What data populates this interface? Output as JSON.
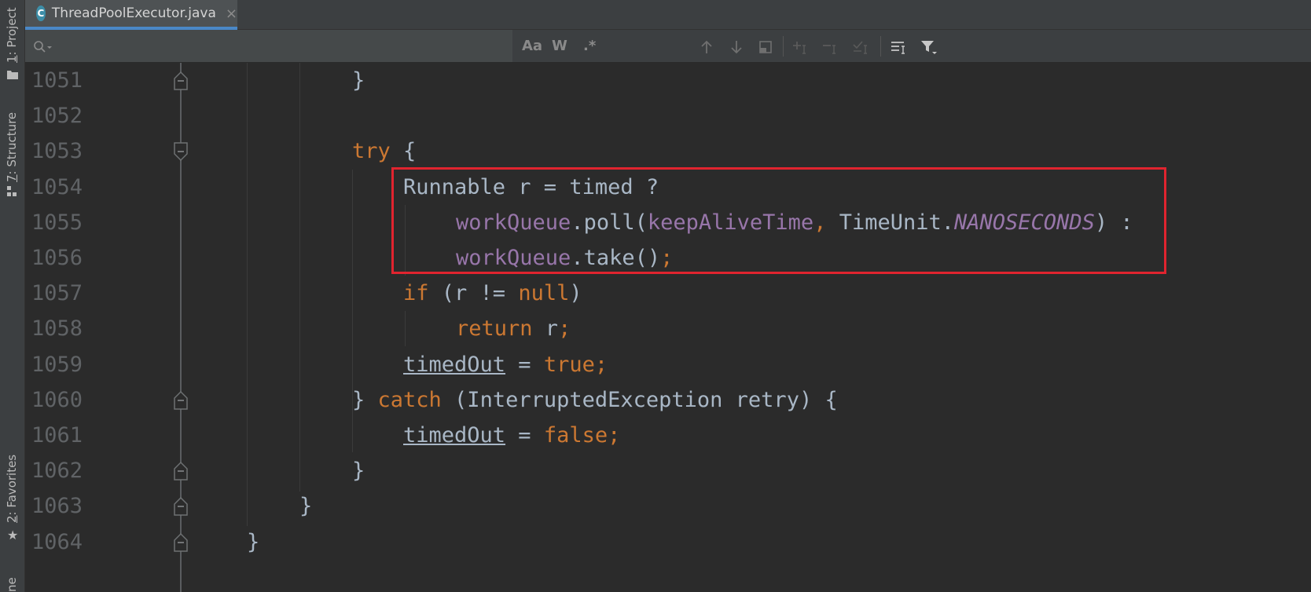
{
  "tool_windows": {
    "project": {
      "number": "1",
      "label": ": Project"
    },
    "structure": {
      "number": "7",
      "label": ": Structure"
    },
    "favorites": {
      "number": "2",
      "label": ": Favorites"
    },
    "bottom_partial": "ne"
  },
  "tab": {
    "file_icon_letter": "C",
    "title": "ThreadPoolExecutor.java",
    "close_glyph": "×"
  },
  "search": {
    "value": "",
    "placeholder": "",
    "match_case": "Aa",
    "words": "W",
    "regex": ".*"
  },
  "editor": {
    "lines": [
      {
        "number": "1051",
        "tokens": [
          {
            "t": "}",
            "c": ""
          }
        ]
      },
      {
        "number": "1052",
        "tokens": []
      },
      {
        "number": "1053",
        "tokens": [
          {
            "t": "try",
            "c": "kw"
          },
          {
            "t": " {",
            "c": ""
          }
        ]
      },
      {
        "number": "1054",
        "tokens": [
          {
            "t": "Runnable r = timed ?",
            "c": ""
          }
        ]
      },
      {
        "number": "1055",
        "tokens": [
          {
            "t": "workQueue",
            "c": "fld"
          },
          {
            "t": ".poll(",
            "c": ""
          },
          {
            "t": "keepAliveTime",
            "c": "fld"
          },
          {
            "t": ", ",
            "c": "kw"
          },
          {
            "t": "TimeUnit.",
            "c": ""
          },
          {
            "t": "NANOSECONDS",
            "c": "cst"
          },
          {
            "t": ") :",
            "c": ""
          }
        ]
      },
      {
        "number": "1056",
        "tokens": [
          {
            "t": "workQueue",
            "c": "fld"
          },
          {
            "t": ".take()",
            "c": ""
          },
          {
            "t": ";",
            "c": "kw"
          }
        ]
      },
      {
        "number": "1057",
        "tokens": [
          {
            "t": "if",
            "c": "kw"
          },
          {
            "t": " (r != ",
            "c": ""
          },
          {
            "t": "null",
            "c": "kw"
          },
          {
            "t": ")",
            "c": ""
          }
        ]
      },
      {
        "number": "1058",
        "tokens": [
          {
            "t": "return",
            "c": "kw"
          },
          {
            "t": " r",
            "c": ""
          },
          {
            "t": ";",
            "c": "kw"
          }
        ]
      },
      {
        "number": "1059",
        "tokens": [
          {
            "t": "timedOut",
            "c": "udl"
          },
          {
            "t": " = ",
            "c": ""
          },
          {
            "t": "true",
            "c": "kw"
          },
          {
            "t": ";",
            "c": "kw"
          }
        ]
      },
      {
        "number": "1060",
        "tokens": [
          {
            "t": "} ",
            "c": ""
          },
          {
            "t": "catch",
            "c": "kw"
          },
          {
            "t": " (InterruptedException retry) {",
            "c": ""
          }
        ]
      },
      {
        "number": "1061",
        "tokens": [
          {
            "t": "timedOut",
            "c": "udl"
          },
          {
            "t": " = ",
            "c": ""
          },
          {
            "t": "false",
            "c": "kw"
          },
          {
            "t": ";",
            "c": "kw"
          }
        ]
      },
      {
        "number": "1062",
        "tokens": [
          {
            "t": "}",
            "c": ""
          }
        ]
      },
      {
        "number": "1063",
        "tokens": [
          {
            "t": "}",
            "c": ""
          }
        ]
      },
      {
        "number": "1064",
        "tokens": [
          {
            "t": "}",
            "c": ""
          }
        ]
      }
    ]
  },
  "colors": {
    "keyword": "#cc7832",
    "field": "#9876aa",
    "text": "#a9b7c6",
    "line_number": "#606366",
    "background": "#2b2b2b",
    "highlight_box": "#e0242f",
    "tab_underline": "#4a88c7"
  },
  "icons": {
    "search": "magnifier-icon",
    "newline": "enter-icon",
    "prev": "arrow-up-icon",
    "next": "arrow-down-icon",
    "select_all": "select-all-occurrences-icon",
    "add_selection": "add-selection-icon",
    "remove_selection": "remove-selection-icon",
    "select_all_checkbox": "checklist-icon",
    "filter": "filter-icon",
    "multiline": "multiline-icon"
  }
}
